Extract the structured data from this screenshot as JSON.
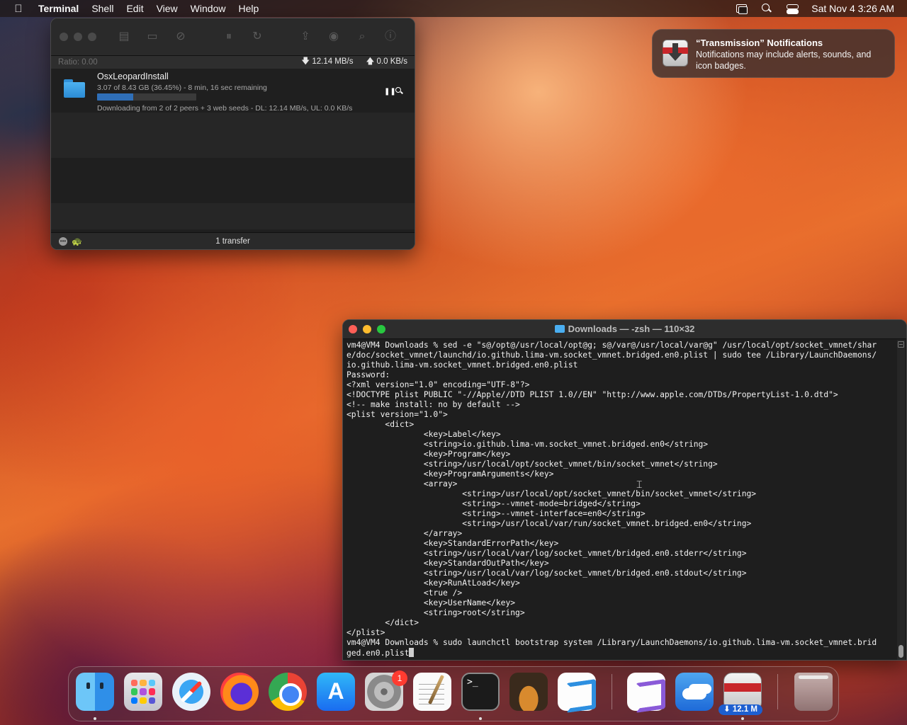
{
  "menubar": {
    "app_name": "Terminal",
    "menus": [
      "Shell",
      "Edit",
      "View",
      "Window",
      "Help"
    ],
    "clock": "Sat Nov 4  3:26 AM",
    "icons": [
      "apple-icon",
      "windows-icon",
      "search-icon",
      "control-center-icon"
    ]
  },
  "transmission": {
    "status": {
      "ratio": "Ratio: 0.00",
      "download_speed": "12.14 MB/s",
      "upload_speed": "0.0 KB/s"
    },
    "torrent": {
      "name": "OsxLeopardInstall",
      "progress_text": "3.07 of 8.43 GB (36.45%) - 8 min, 16 sec remaining",
      "progress_fraction": 0.3645,
      "peers_text": "Downloading from 2 of 2 peers + 3 web seeds - DL: 12.14 MB/s, UL: 0.0 KB/s"
    },
    "footer": {
      "transfer_count": "1 transfer"
    }
  },
  "notification": {
    "title": "“Transmission” Notifications",
    "body": "Notifications may include alerts, sounds, and icon badges."
  },
  "terminal": {
    "title": "Downloads — -zsh — 110×32",
    "lines": [
      "vm4@VM4 Downloads % sed -e \"s@/opt@/usr/local/opt@g; s@/var@/usr/local/var@g\" /usr/local/opt/socket_vmnet/shar",
      "e/doc/socket_vmnet/launchd/io.github.lima-vm.socket_vmnet.bridged.en0.plist | sudo tee /Library/LaunchDaemons/",
      "io.github.lima-vm.socket_vmnet.bridged.en0.plist",
      "Password:",
      "<?xml version=\"1.0\" encoding=\"UTF-8\"?>",
      "<!DOCTYPE plist PUBLIC \"-//Apple//DTD PLIST 1.0//EN\" \"http://www.apple.com/DTDs/PropertyList-1.0.dtd\">",
      "<!-- make install: no by default -->",
      "<plist version=\"1.0\">",
      "        <dict>",
      "                <key>Label</key>",
      "                <string>io.github.lima-vm.socket_vmnet.bridged.en0</string>",
      "                <key>Program</key>",
      "                <string>/usr/local/opt/socket_vmnet/bin/socket_vmnet</string>",
      "                <key>ProgramArguments</key>",
      "                <array>",
      "                        <string>/usr/local/opt/socket_vmnet/bin/socket_vmnet</string>",
      "                        <string>--vmnet-mode=bridged</string>",
      "                        <string>--vmnet-interface=en0</string>",
      "                        <string>/usr/local/var/run/socket_vmnet.bridged.en0</string>",
      "                </array>",
      "                <key>StandardErrorPath</key>",
      "                <string>/usr/local/var/log/socket_vmnet/bridged.en0.stderr</string>",
      "                <key>StandardOutPath</key>",
      "                <string>/usr/local/var/log/socket_vmnet/bridged.en0.stdout</string>",
      "                <key>RunAtLoad</key>",
      "                <true />",
      "                <key>UserName</key>",
      "                <string>root</string>",
      "        </dict>",
      "</plist>",
      "vm4@VM4 Downloads % sudo launchctl bootstrap system /Library/LaunchDaemons/io.github.lima-vm.socket_vmnet.brid",
      "ged.en0.plist"
    ]
  },
  "dock": {
    "apps": [
      {
        "name": "Finder",
        "icon": "finder-icon",
        "running": true
      },
      {
        "name": "Launchpad",
        "icon": "launchpad-icon",
        "running": false
      },
      {
        "name": "Safari",
        "icon": "safari-icon",
        "running": false
      },
      {
        "name": "Firefox",
        "icon": "firefox-icon",
        "running": false
      },
      {
        "name": "Google Chrome",
        "icon": "chrome-icon",
        "running": false
      },
      {
        "name": "App Store",
        "icon": "app-store-icon",
        "running": false
      },
      {
        "name": "System Settings",
        "icon": "settings-icon",
        "running": false
      },
      {
        "name": "TextEdit",
        "icon": "textedit-icon",
        "running": false
      },
      {
        "name": "Terminal",
        "icon": "terminal-icon",
        "running": true
      },
      {
        "name": "GarageBand",
        "icon": "garageband-icon",
        "running": false
      },
      {
        "name": "Visual Studio Code",
        "icon": "vscode-icon",
        "running": false
      },
      {
        "name": "Visual Studio",
        "icon": "visual-studio-icon",
        "running": false
      },
      {
        "name": "Weather",
        "icon": "weather-icon",
        "running": false
      },
      {
        "name": "Transmission",
        "icon": "transmission-icon",
        "running": true
      },
      {
        "name": "Trash",
        "icon": "trash-icon",
        "running": false
      }
    ],
    "settings_badge": "1",
    "transmission_badge": "⬇ 12.1 M"
  },
  "colors": {
    "terminal_bg": "#1e1e1e",
    "progress_fill": "#2f6fb8",
    "badge_red": "#ff3b30",
    "download_badge_blue": "#1d5fd0"
  }
}
